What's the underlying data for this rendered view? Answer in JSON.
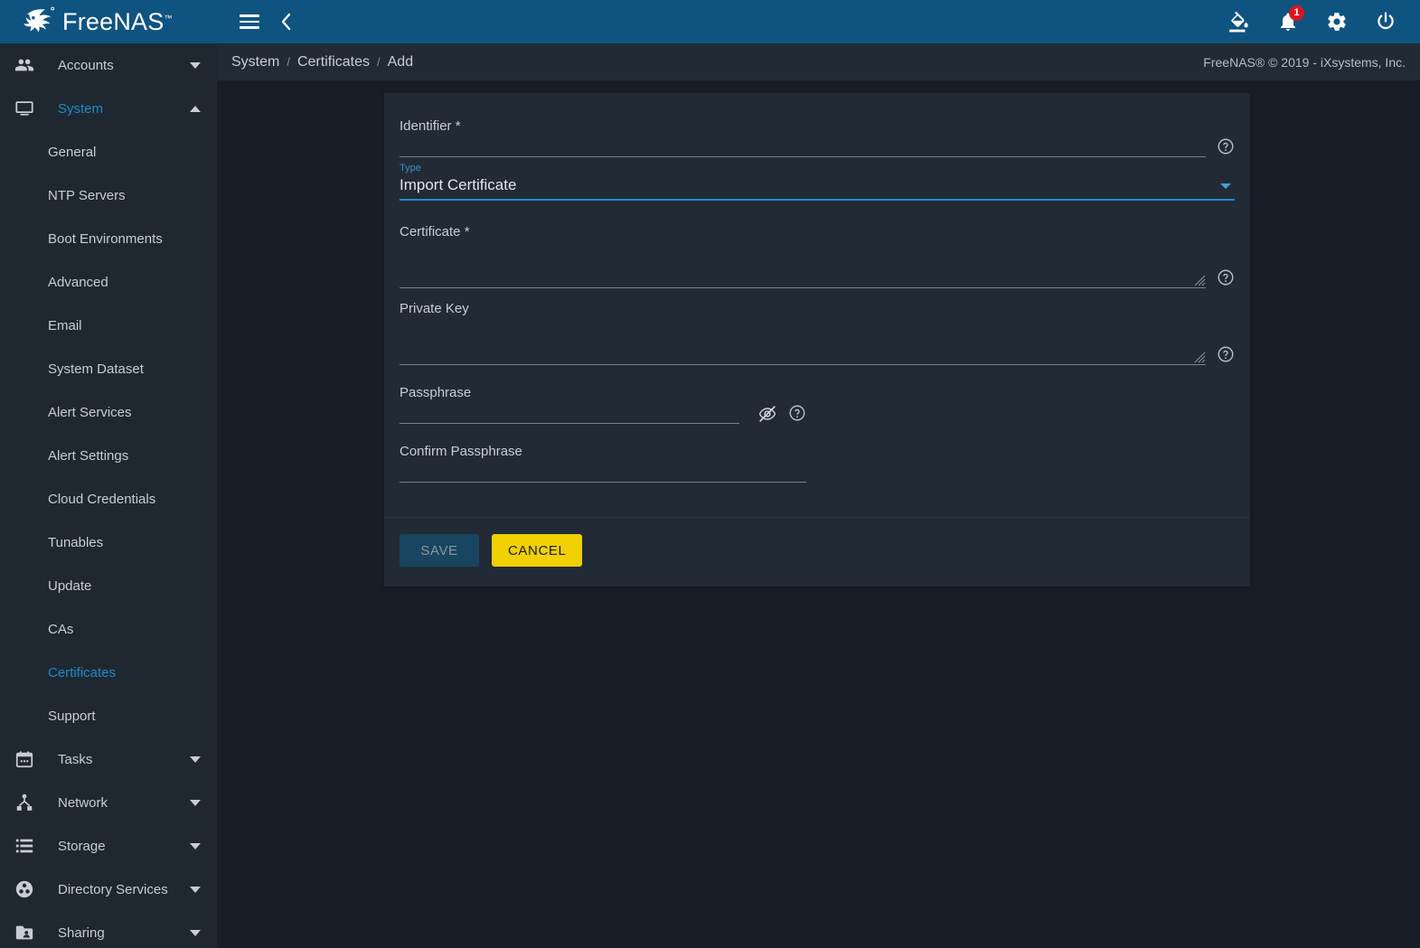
{
  "app": {
    "brand_name": "FreeNAS",
    "brand_tm": "™",
    "accent_blue": "#1f8ac9",
    "header_blue": "#0f5381",
    "page_bg": "#171e26",
    "card_bg": "#222b35",
    "sidebar_bg": "#1f2831",
    "cancel_yellow": "#f0d000"
  },
  "topbar": {
    "menu_icon": "hamburger-menu-icon",
    "back_icon": "chevron-left-icon",
    "theme_icon": "paint-bucket-icon",
    "notifications_icon": "bell-icon",
    "notifications_count": "1",
    "settings_icon": "gear-icon",
    "power_icon": "power-icon"
  },
  "breadcrumb": {
    "items": [
      "System",
      "Certificates",
      "Add"
    ],
    "separator": "/",
    "copyright": "FreeNAS® © 2019 - iXsystems, Inc."
  },
  "sidebar": {
    "groups": [
      {
        "label": "Accounts",
        "icon": "accounts-people-icon",
        "expanded": false,
        "active": false,
        "children": []
      },
      {
        "label": "System",
        "icon": "system-monitor-icon",
        "expanded": true,
        "active": true,
        "children": [
          {
            "label": "General",
            "active": false
          },
          {
            "label": "NTP Servers",
            "active": false
          },
          {
            "label": "Boot Environments",
            "active": false
          },
          {
            "label": "Advanced",
            "active": false
          },
          {
            "label": "Email",
            "active": false
          },
          {
            "label": "System Dataset",
            "active": false
          },
          {
            "label": "Alert Services",
            "active": false
          },
          {
            "label": "Alert Settings",
            "active": false
          },
          {
            "label": "Cloud Credentials",
            "active": false
          },
          {
            "label": "Tunables",
            "active": false
          },
          {
            "label": "Update",
            "active": false
          },
          {
            "label": "CAs",
            "active": false
          },
          {
            "label": "Certificates",
            "active": true
          },
          {
            "label": "Support",
            "active": false
          }
        ]
      },
      {
        "label": "Tasks",
        "icon": "calendar-icon",
        "expanded": false,
        "active": false,
        "children": []
      },
      {
        "label": "Network",
        "icon": "network-share-icon",
        "expanded": false,
        "active": false,
        "children": []
      },
      {
        "label": "Storage",
        "icon": "storage-list-icon",
        "expanded": false,
        "active": false,
        "children": []
      },
      {
        "label": "Directory Services",
        "icon": "directory-services-icon",
        "expanded": false,
        "active": false,
        "children": []
      },
      {
        "label": "Sharing",
        "icon": "shared-folder-icon",
        "expanded": false,
        "active": false,
        "children": []
      }
    ]
  },
  "form": {
    "identifier": {
      "label": "Identifier *",
      "value": "",
      "placeholder": "",
      "help_icon": "help-circle-icon"
    },
    "type": {
      "mini_label": "Type",
      "selected": "Import Certificate",
      "arrow_icon": "chevron-down-icon"
    },
    "certificate": {
      "label": "Certificate *",
      "value": "",
      "placeholder": "",
      "help_icon": "help-circle-icon",
      "resize_icon": "resize-grip-icon"
    },
    "private_key": {
      "label": "Private Key",
      "value": "",
      "placeholder": "",
      "help_icon": "help-circle-icon",
      "resize_icon": "resize-grip-icon"
    },
    "passphrase": {
      "label": "Passphrase",
      "value": "",
      "placeholder": "",
      "visibility_icon": "eye-off-icon",
      "help_icon": "help-circle-icon"
    },
    "confirm_passphrase": {
      "label": "Confirm Passphrase",
      "value": "",
      "placeholder": ""
    },
    "actions": {
      "save_label": "SAVE",
      "save_disabled": true,
      "cancel_label": "CANCEL"
    }
  }
}
